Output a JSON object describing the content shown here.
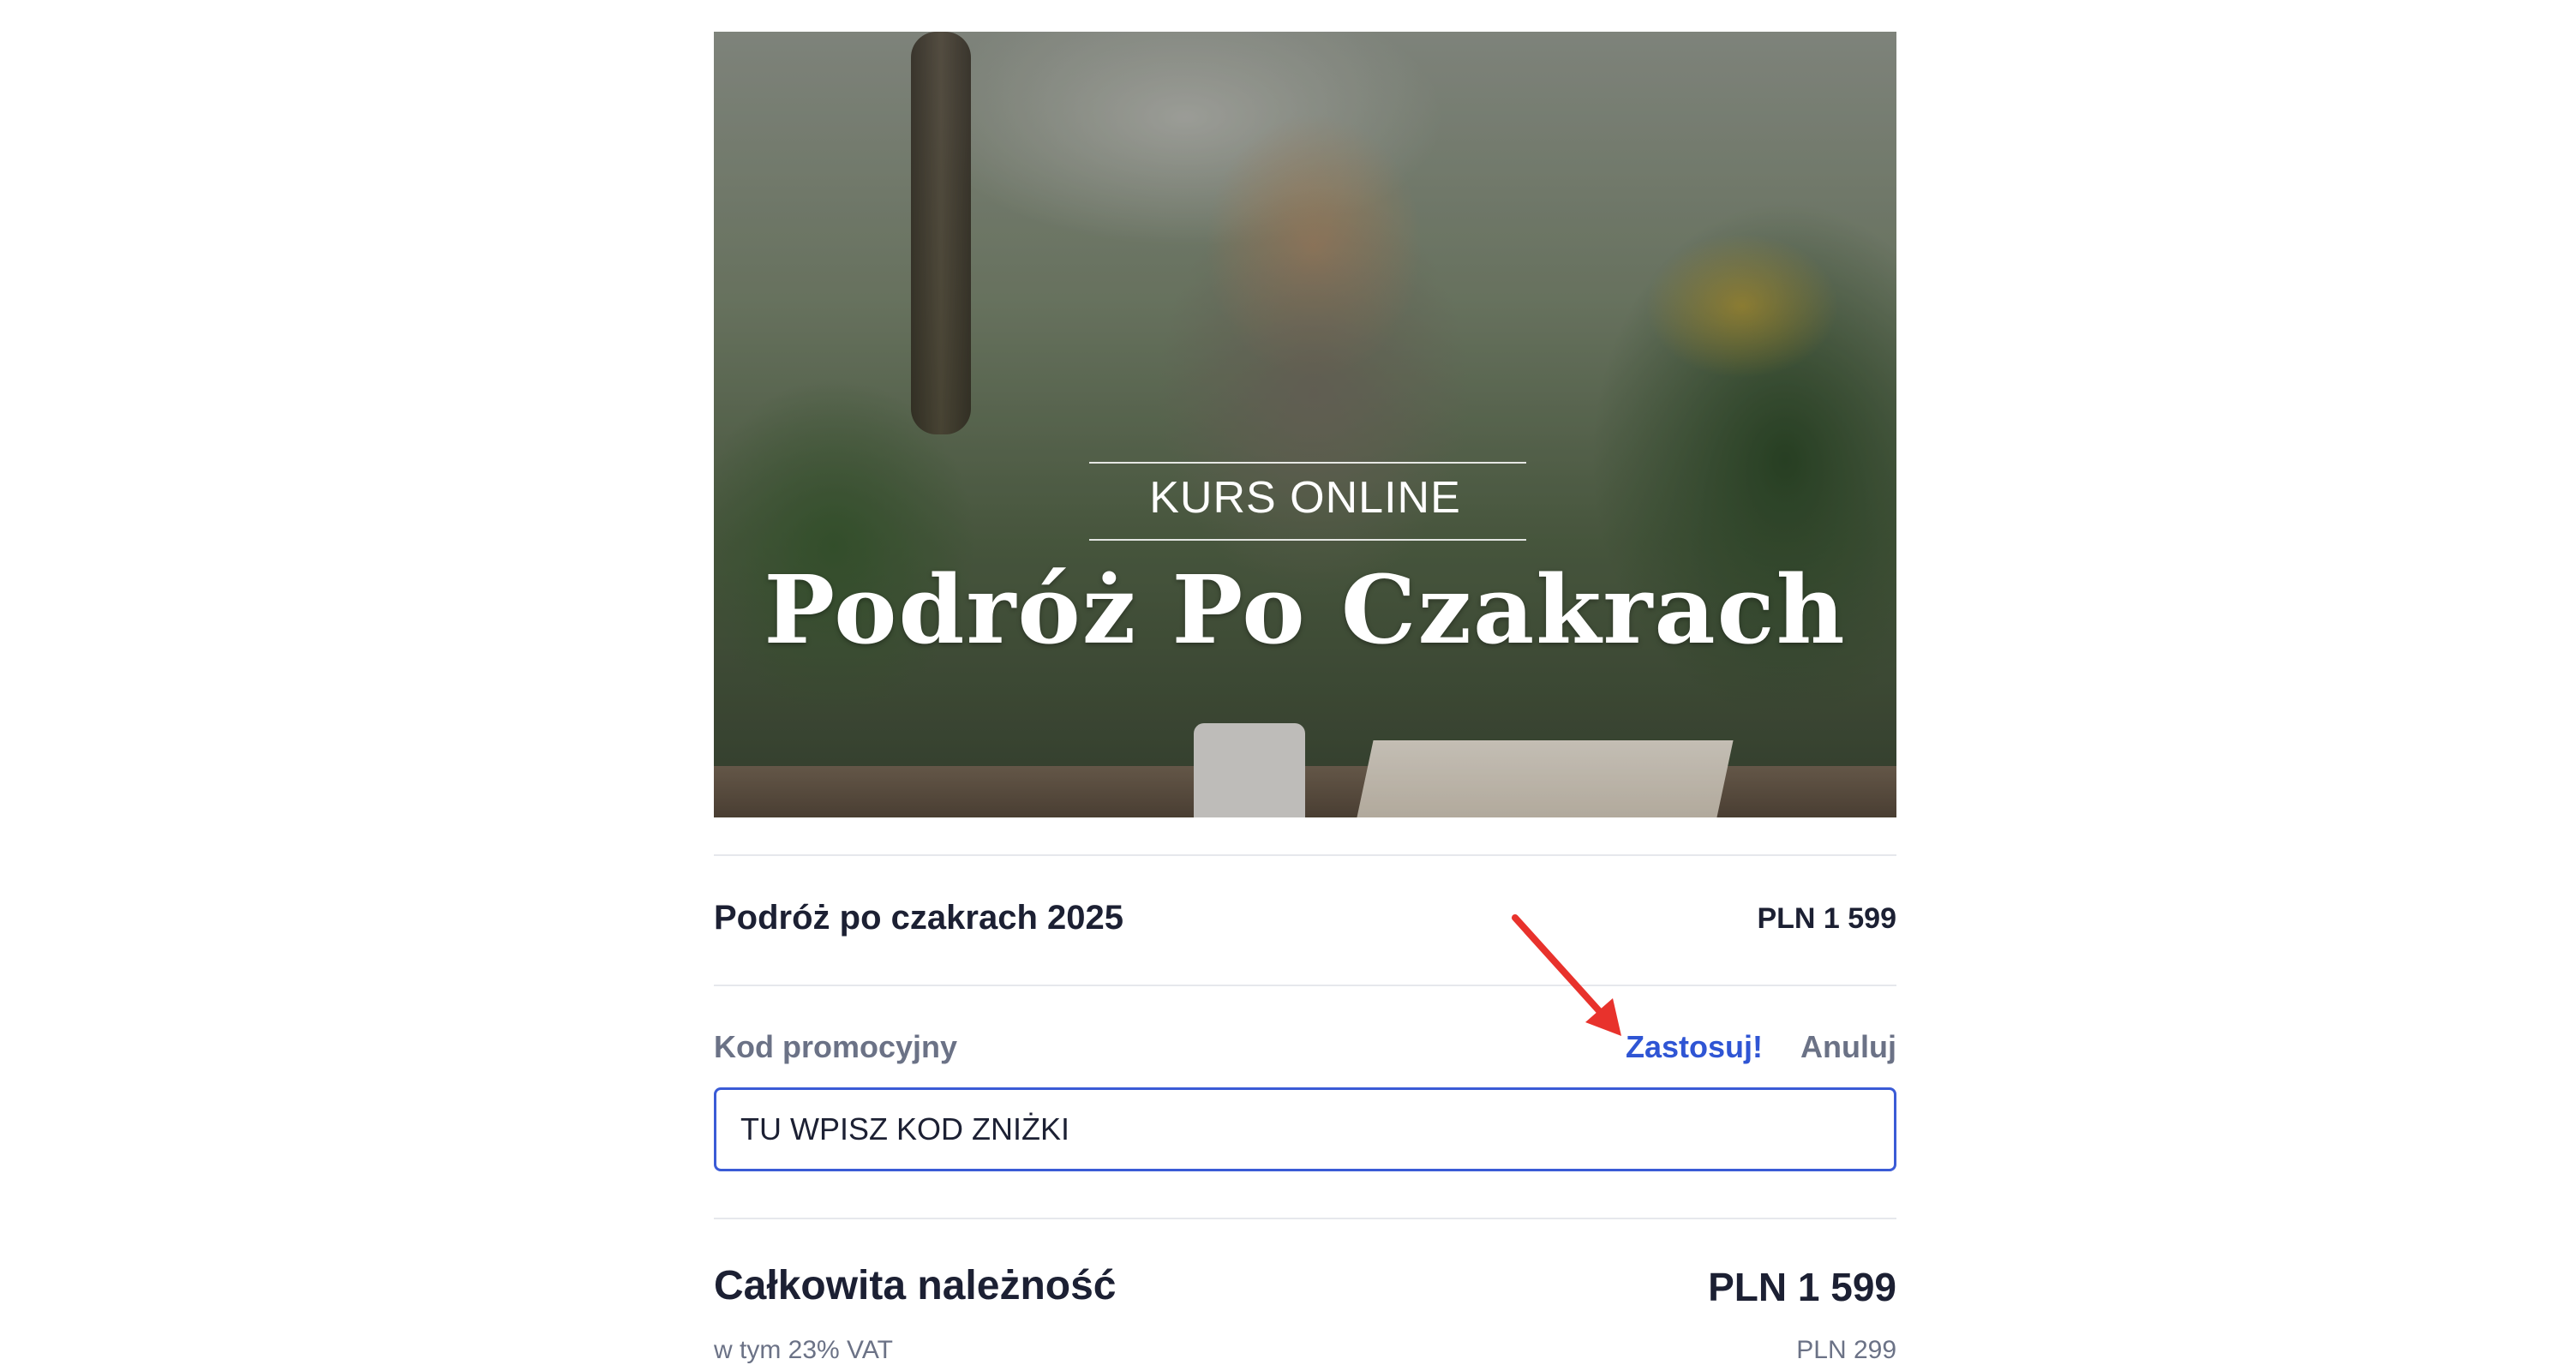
{
  "hero": {
    "eyebrow": "KURS ONLINE",
    "title": "Podróż Po Czakrach"
  },
  "product": {
    "name": "Podróż po czakrach 2025",
    "price": "PLN 1 599"
  },
  "promo": {
    "label": "Kod promocyjny",
    "apply_label": "Zastosuj!",
    "cancel_label": "Anuluj",
    "input_value": "TU WPISZ KOD ZNIŻKI"
  },
  "total": {
    "label": "Całkowita należność",
    "price": "PLN 1 599",
    "vat_label": "w tym 23% VAT",
    "vat_price": "PLN 299"
  },
  "colors": {
    "accent": "#2f55d4",
    "annotation_arrow": "#e8322c"
  },
  "icons": {
    "annotation": "arrow-pointer-icon"
  }
}
